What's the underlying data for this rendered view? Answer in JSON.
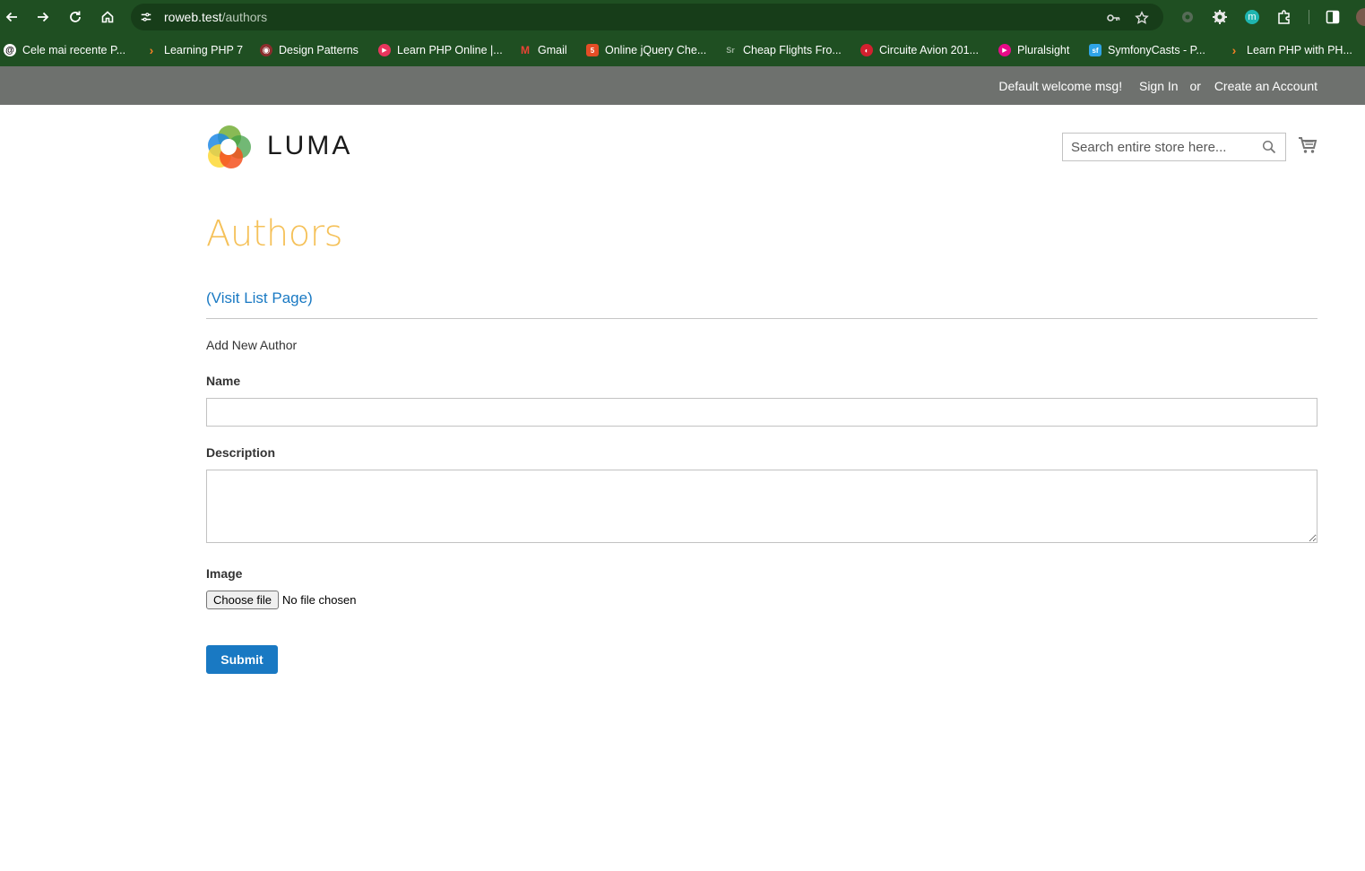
{
  "browser": {
    "url_host": "roweb.test",
    "url_path": "/authors",
    "bookmarks": [
      {
        "label": "Cele mai recente P...",
        "icon": "threads-icon",
        "color": "#000000"
      },
      {
        "label": "Learning PHP 7",
        "icon": "chevron-bookmark-icon",
        "color": "#f48024"
      },
      {
        "label": "Design Patterns",
        "icon": "raccoon-icon",
        "color": "#8b2d2d"
      },
      {
        "label": "Learn PHP Online |...",
        "icon": "play-circle-icon",
        "color": "#e8355d"
      },
      {
        "label": "Gmail",
        "icon": "gmail-icon",
        "color": "#ea4335"
      },
      {
        "label": "Online jQuery Che...",
        "icon": "html5-icon",
        "color": "#e44d26"
      },
      {
        "label": "Cheap Flights Fro...",
        "icon": "sr-icon",
        "color": "#1f4f22"
      },
      {
        "label": "Circuite Avion 201...",
        "icon": "globe-icon",
        "color": "#d3202f"
      },
      {
        "label": "Pluralsight",
        "icon": "pluralsight-icon",
        "color": "#e80a89"
      },
      {
        "label": "SymfonyCasts - P...",
        "icon": "symfonycasts-icon",
        "color": "#2fa4e7"
      },
      {
        "label": "Learn PHP with PH...",
        "icon": "chevron-bookmark-icon",
        "color": "#f48024"
      }
    ]
  },
  "header": {
    "welcome": "Default welcome msg!",
    "sign_in": "Sign In",
    "or": "or",
    "create_account": "Create an Account",
    "logo_text": "LUMA",
    "search_placeholder": "Search entire store here..."
  },
  "main": {
    "title": "Authors",
    "list_link": "(Visit List Page)",
    "form_title": "Add New Author",
    "name_label": "Name",
    "description_label": "Description",
    "image_label": "Image",
    "file_button": "Choose file",
    "file_status": "No file chosen",
    "submit_label": "Submit"
  },
  "colors": {
    "accent": "#1979c3",
    "title": "#f5c159",
    "panel": "#6e716e",
    "chrome": "#1f4f22"
  }
}
